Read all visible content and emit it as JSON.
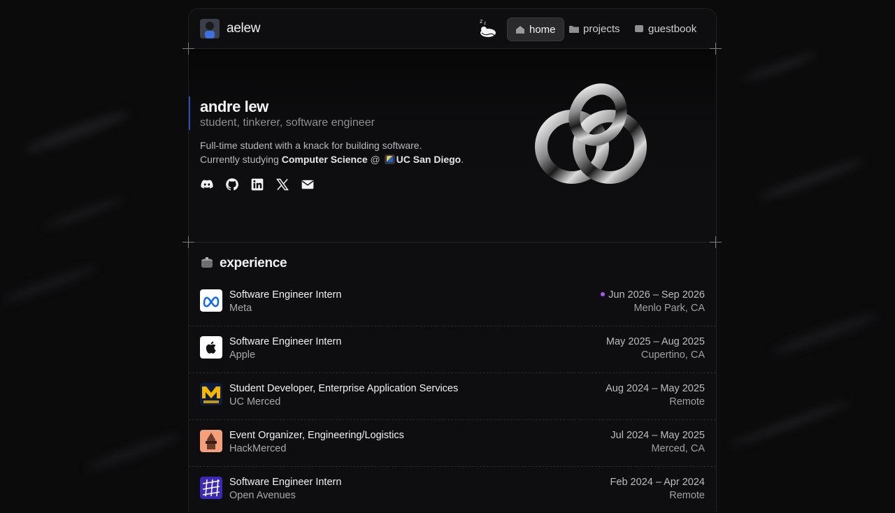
{
  "header": {
    "logo_text": "aelew",
    "nav": [
      {
        "label": "home",
        "icon": "house-icon",
        "active": true
      },
      {
        "label": "projects",
        "icon": "folder-icon",
        "active": false
      },
      {
        "label": "guestbook",
        "icon": "notebook-icon",
        "active": false
      }
    ]
  },
  "hero": {
    "name": "andre lew",
    "tagline": "student, tinkerer, software engineer",
    "bio_line1": "Full-time student with a knack for building software.",
    "bio_prefix": "Currently studying",
    "major": "Computer Science",
    "at": "@",
    "school": "UC San Diego",
    "period": ".",
    "socials": [
      "discord-icon",
      "github-icon",
      "linkedin-icon",
      "x-icon",
      "mail-icon"
    ]
  },
  "experience": {
    "title": "experience",
    "items": [
      {
        "role": "Software Engineer Intern",
        "org": "Meta",
        "dates": "Jun 2026 – Sep 2026",
        "location": "Menlo Park, CA",
        "upcoming": true
      },
      {
        "role": "Software Engineer Intern",
        "org": "Apple",
        "dates": "May 2025 – Aug 2025",
        "location": "Cupertino, CA"
      },
      {
        "role": "Student Developer, Enterprise Application Services",
        "org": "UC Merced",
        "dates": "Aug 2024 – May 2025",
        "location": "Remote"
      },
      {
        "role": "Event Organizer, Engineering/Logistics",
        "org": "HackMerced",
        "dates": "Jul 2024 – May 2025",
        "location": "Merced, CA"
      },
      {
        "role": "Software Engineer Intern",
        "org": "Open Avenues",
        "dates": "Feb 2024 – Apr 2024",
        "location": "Remote"
      }
    ]
  },
  "colors": {
    "accent": "#3b6cff",
    "upcoming_dot": "#a855f7",
    "background": "#0b0b0c"
  }
}
